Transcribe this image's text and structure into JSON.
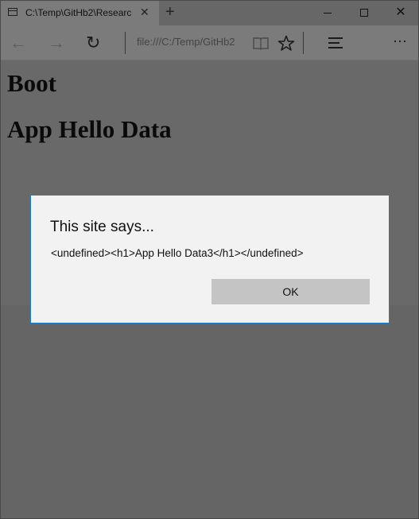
{
  "browser": {
    "tab_title": "C:\\Temp\\GitHb2\\Researc",
    "tab_close": "✕",
    "new_tab": "+",
    "address": "file:///C:/Temp/GitHb2",
    "icons": [
      "window-icon",
      "back-arrow-icon",
      "forward-arrow-icon",
      "refresh-icon",
      "reading-view-icon",
      "favorite-star-icon",
      "hub-icon",
      "more-icon",
      "minimize-icon",
      "maximize-icon",
      "close-icon"
    ]
  },
  "page": {
    "heading1": "Boot",
    "heading2": "App Hello Data"
  },
  "dialog": {
    "title": "This site says...",
    "message": "<undefined><h1>App Hello Data3</h1></undefined>",
    "ok_label": "OK",
    "border_color": "#1b7fd4"
  }
}
